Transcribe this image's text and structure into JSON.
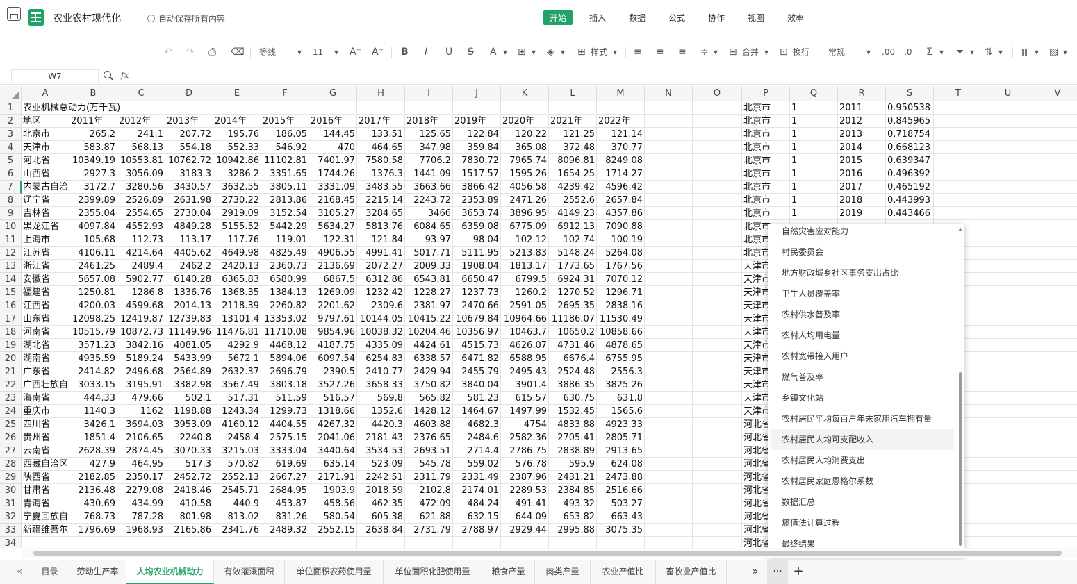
{
  "app": {
    "title": "农业农村现代化",
    "autosave": "自动保存所有内容"
  },
  "menu": [
    "开始",
    "插入",
    "数据",
    "公式",
    "协作",
    "视图",
    "效率"
  ],
  "toolbar": {
    "font": "等线",
    "size": "11",
    "style_label": "样式",
    "merge_label": "合并",
    "wrap_label": "换行",
    "format_label": "常规"
  },
  "formula": {
    "cellref": "W7",
    "fx": "fx"
  },
  "columns": [
    "A",
    "B",
    "C",
    "D",
    "E",
    "F",
    "G",
    "H",
    "I",
    "J",
    "K",
    "L",
    "M",
    "N",
    "O",
    "P",
    "Q",
    "R",
    "S",
    "T",
    "U",
    "V"
  ],
  "rows": [
    [
      "农业机械总动力(万千瓦)",
      "",
      "",
      "",
      "",
      "",
      "",
      "",
      "",
      "",
      "",
      "",
      ""
    ],
    [
      "地区",
      "2011年",
      "2012年",
      "2013年",
      "2014年",
      "2015年",
      "2016年",
      "2017年",
      "2018年",
      "2019年",
      "2020年",
      "2021年",
      "2022年"
    ],
    [
      "北京市",
      "265.2",
      "241.1",
      "207.72",
      "195.76",
      "186.05",
      "144.45",
      "133.51",
      "125.65",
      "122.84",
      "120.22",
      "121.25",
      "121.14"
    ],
    [
      "天津市",
      "583.87",
      "568.13",
      "554.18",
      "552.33",
      "546.92",
      "470",
      "464.65",
      "347.98",
      "359.84",
      "365.08",
      "372.48",
      "370.77"
    ],
    [
      "河北省",
      "10349.19",
      "10553.81",
      "10762.72",
      "10942.86",
      "11102.81",
      "7401.97",
      "7580.58",
      "7706.2",
      "7830.72",
      "7965.74",
      "8096.81",
      "8249.08"
    ],
    [
      "山西省",
      "2927.3",
      "3056.09",
      "3183.3",
      "3286.2",
      "3351.65",
      "1744.26",
      "1376.3",
      "1441.09",
      "1517.57",
      "1595.26",
      "1654.25",
      "1714.27"
    ],
    [
      "内蒙古自治区",
      "3172.7",
      "3280.56",
      "3430.57",
      "3632.55",
      "3805.11",
      "3331.09",
      "3483.55",
      "3663.66",
      "3866.42",
      "4056.58",
      "4239.42",
      "4596.42"
    ],
    [
      "辽宁省",
      "2399.89",
      "2526.89",
      "2631.98",
      "2730.22",
      "2813.86",
      "2168.45",
      "2215.14",
      "2243.72",
      "2353.89",
      "2471.26",
      "2552.6",
      "2657.84"
    ],
    [
      "吉林省",
      "2355.04",
      "2554.65",
      "2730.04",
      "2919.09",
      "3152.54",
      "3105.27",
      "3284.65",
      "3466",
      "3653.74",
      "3896.95",
      "4149.23",
      "4357.86"
    ],
    [
      "黑龙江省",
      "4097.84",
      "4552.93",
      "4849.28",
      "5155.52",
      "5442.29",
      "5634.27",
      "5813.76",
      "6084.65",
      "6359.08",
      "6775.09",
      "6912.13",
      "7090.88"
    ],
    [
      "上海市",
      "105.68",
      "112.73",
      "113.17",
      "117.76",
      "119.01",
      "122.31",
      "121.84",
      "93.97",
      "98.04",
      "102.12",
      "102.74",
      "100.19"
    ],
    [
      "江苏省",
      "4106.11",
      "4214.64",
      "4405.62",
      "4649.98",
      "4825.49",
      "4906.55",
      "4991.41",
      "5017.71",
      "5111.95",
      "5213.83",
      "5148.24",
      "5264.08"
    ],
    [
      "浙江省",
      "2461.25",
      "2489.4",
      "2462.2",
      "2420.13",
      "2360.73",
      "2136.69",
      "2072.27",
      "2009.33",
      "1908.04",
      "1813.17",
      "1773.65",
      "1767.56"
    ],
    [
      "安徽省",
      "5657.08",
      "5902.77",
      "6140.28",
      "6365.83",
      "6580.99",
      "6867.5",
      "6312.86",
      "6543.81",
      "6650.47",
      "6799.5",
      "6924.31",
      "7070.12"
    ],
    [
      "福建省",
      "1250.81",
      "1286.8",
      "1336.76",
      "1368.35",
      "1384.13",
      "1269.09",
      "1232.42",
      "1228.27",
      "1237.73",
      "1260.2",
      "1270.52",
      "1296.71"
    ],
    [
      "江西省",
      "4200.03",
      "4599.68",
      "2014.13",
      "2118.39",
      "2260.82",
      "2201.62",
      "2309.6",
      "2381.97",
      "2470.66",
      "2591.05",
      "2695.35",
      "2838.16"
    ],
    [
      "山东省",
      "12098.25",
      "12419.87",
      "12739.83",
      "13101.4",
      "13353.02",
      "9797.61",
      "10144.05",
      "10415.22",
      "10679.84",
      "10964.66",
      "11186.07",
      "11530.49"
    ],
    [
      "河南省",
      "10515.79",
      "10872.73",
      "11149.96",
      "11476.81",
      "11710.08",
      "9854.96",
      "10038.32",
      "10204.46",
      "10356.97",
      "10463.7",
      "10650.2",
      "10858.66"
    ],
    [
      "湖北省",
      "3571.23",
      "3842.16",
      "4081.05",
      "4292.9",
      "4468.12",
      "4187.75",
      "4335.09",
      "4424.61",
      "4515.73",
      "4626.07",
      "4731.46",
      "4878.65"
    ],
    [
      "湖南省",
      "4935.59",
      "5189.24",
      "5433.99",
      "5672.1",
      "5894.06",
      "6097.54",
      "6254.83",
      "6338.57",
      "6471.82",
      "6588.95",
      "6676.4",
      "6755.95"
    ],
    [
      "广东省",
      "2414.82",
      "2496.68",
      "2564.89",
      "2632.37",
      "2696.79",
      "2390.5",
      "2410.77",
      "2429.94",
      "2455.79",
      "2495.43",
      "2524.48",
      "2556.3"
    ],
    [
      "广西壮族自治区",
      "3033.15",
      "3195.91",
      "3382.98",
      "3567.49",
      "3803.18",
      "3527.26",
      "3658.33",
      "3750.82",
      "3840.04",
      "3901.4",
      "3886.35",
      "3825.26"
    ],
    [
      "海南省",
      "444.33",
      "479.66",
      "502.1",
      "517.31",
      "511.59",
      "516.57",
      "569.8",
      "565.82",
      "581.23",
      "615.57",
      "630.75",
      "631.8"
    ],
    [
      "重庆市",
      "1140.3",
      "1162",
      "1198.88",
      "1243.34",
      "1299.73",
      "1318.66",
      "1352.6",
      "1428.12",
      "1464.67",
      "1497.99",
      "1532.45",
      "1565.6"
    ],
    [
      "四川省",
      "3426.1",
      "3694.03",
      "3953.09",
      "4160.12",
      "4404.55",
      "4267.32",
      "4420.3",
      "4603.88",
      "4682.3",
      "4754",
      "4833.88",
      "4923.33"
    ],
    [
      "贵州省",
      "1851.4",
      "2106.65",
      "2240.8",
      "2458.4",
      "2575.15",
      "2041.06",
      "2181.43",
      "2376.65",
      "2484.6",
      "2582.36",
      "2705.41",
      "2805.71"
    ],
    [
      "云南省",
      "2628.39",
      "2874.45",
      "3070.33",
      "3215.03",
      "3333.04",
      "3440.64",
      "3534.53",
      "2693.51",
      "2714.4",
      "2786.75",
      "2838.89",
      "2913.65"
    ],
    [
      "西藏自治区",
      "427.9",
      "464.95",
      "517.3",
      "570.82",
      "619.69",
      "635.14",
      "523.09",
      "545.78",
      "559.02",
      "576.78",
      "595.9",
      "624.08"
    ],
    [
      "陕西省",
      "2182.85",
      "2350.17",
      "2452.72",
      "2552.13",
      "2667.27",
      "2171.91",
      "2242.51",
      "2311.79",
      "2331.49",
      "2387.96",
      "2431.21",
      "2473.88"
    ],
    [
      "甘肃省",
      "2136.48",
      "2279.08",
      "2418.46",
      "2545.71",
      "2684.95",
      "1903.9",
      "2018.59",
      "2102.8",
      "2174.01",
      "2289.53",
      "2384.85",
      "2516.66"
    ],
    [
      "青海省",
      "430.69",
      "434.99",
      "410.58",
      "440.9",
      "453.87",
      "458.56",
      "462.35",
      "472.09",
      "484.24",
      "491.41",
      "493.32",
      "503.27"
    ],
    [
      "宁夏回族自治区",
      "768.73",
      "787.28",
      "801.98",
      "813.02",
      "831.26",
      "580.54",
      "605.38",
      "621.88",
      "632.15",
      "644.09",
      "653.82",
      "663.43"
    ],
    [
      "新疆维吾尔自治区",
      "1796.69",
      "1968.93",
      "2165.86",
      "2341.76",
      "2489.32",
      "2552.15",
      "2638.84",
      "2731.79",
      "2788.97",
      "2929.44",
      "2995.88",
      "3075.35"
    ],
    [
      "",
      "",
      "",
      "",
      "",
      "",
      "",
      "",
      "",
      "",
      "",
      "",
      ""
    ]
  ],
  "right_rows": [
    [
      "北京市",
      "1",
      "2011",
      "0.950538"
    ],
    [
      "北京市",
      "1",
      "2012",
      "0.845965"
    ],
    [
      "北京市",
      "1",
      "2013",
      "0.718754"
    ],
    [
      "北京市",
      "1",
      "2014",
      "0.668123"
    ],
    [
      "北京市",
      "1",
      "2015",
      "0.639347"
    ],
    [
      "北京市",
      "1",
      "2016",
      "0.496392"
    ],
    [
      "北京市",
      "1",
      "2017",
      "0.465192"
    ],
    [
      "北京市",
      "1",
      "2018",
      "0.443993"
    ],
    [
      "北京市",
      "1",
      "2019",
      "0.443466"
    ],
    [
      "北京市",
      "",
      "",
      ""
    ],
    [
      "北京市",
      "",
      "",
      ""
    ],
    [
      "北京市",
      "",
      "",
      ""
    ],
    [
      "天津市",
      "",
      "",
      ""
    ],
    [
      "天津市",
      "",
      "",
      ""
    ],
    [
      "天津市",
      "",
      "",
      ""
    ],
    [
      "天津市",
      "",
      "",
      ""
    ],
    [
      "天津市",
      "",
      "",
      ""
    ],
    [
      "天津市",
      "",
      "",
      ""
    ],
    [
      "天津市",
      "",
      "",
      ""
    ],
    [
      "天津市",
      "",
      "",
      ""
    ],
    [
      "天津市",
      "",
      "",
      ""
    ],
    [
      "天津市",
      "",
      "",
      ""
    ],
    [
      "天津市",
      "",
      "",
      ""
    ],
    [
      "天津市",
      "",
      "",
      ""
    ],
    [
      "河北省",
      "",
      "",
      ""
    ],
    [
      "河北省",
      "",
      "",
      ""
    ],
    [
      "河北省",
      "",
      "",
      ""
    ],
    [
      "河北省",
      "",
      "",
      ""
    ],
    [
      "河北省",
      "",
      "",
      ""
    ],
    [
      "河北省",
      "",
      "",
      ""
    ],
    [
      "河北省",
      "",
      "",
      ""
    ],
    [
      "河北省",
      "",
      "",
      ""
    ],
    [
      "河北省",
      "",
      "",
      ""
    ],
    [
      "河北省",
      "",
      "",
      ""
    ]
  ],
  "popup": [
    "自然灾害应对能力",
    "村民委员会",
    "地方财政城乡社区事务支出占比",
    "卫生人员覆盖率",
    "农村供水普及率",
    "农村人均用电量",
    "农村宽带接入用户",
    "燃气普及率",
    "乡镇文化站",
    "农村居民平均每百户年末家用汽车拥有量",
    "农村居民人均可支配收入",
    "农村居民人均消费支出",
    "农村居民家庭恩格尔系数",
    "数据汇总",
    "熵值法计算过程",
    "最终结果"
  ],
  "tabs": [
    "目录",
    "劳动生产率",
    "人均农业机械动力",
    "有效灌溉面积",
    "单位面积农药使用量",
    "单位面积化肥使用量",
    "粮食产量",
    "肉类产量",
    "农业产值比",
    "畜牧业产值比"
  ],
  "active_tab": 2,
  "colors": {
    "accent": "#21a366"
  }
}
